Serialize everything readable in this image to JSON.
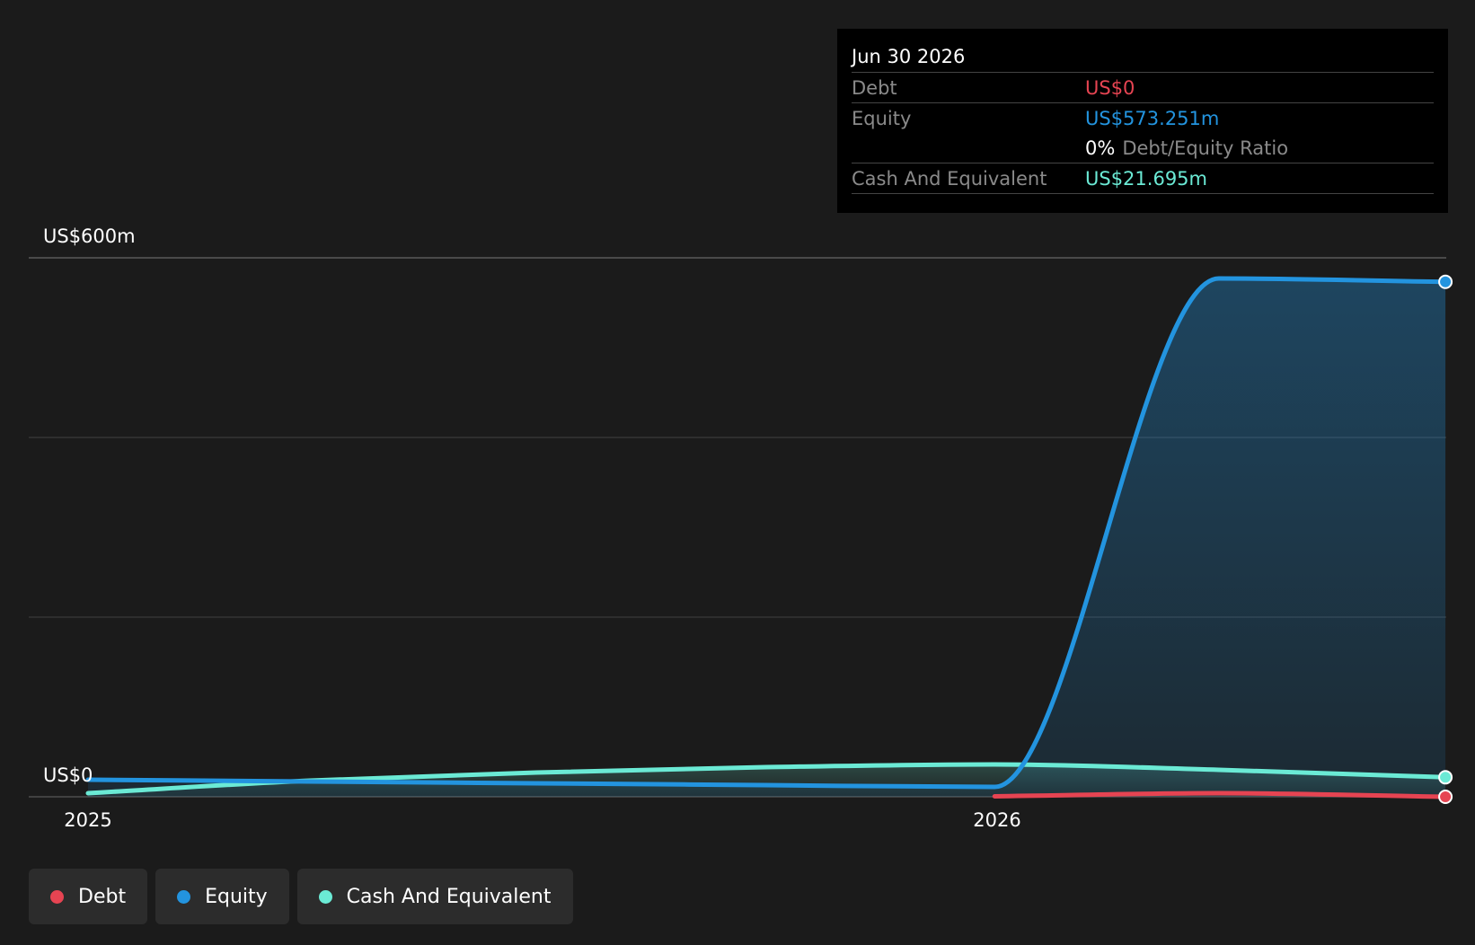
{
  "chart_data": {
    "type": "area",
    "y_tick_labels": [
      "US$600m",
      "US$0"
    ],
    "ylim": [
      0,
      600
    ],
    "x_tick_labels": [
      "2025",
      "2026"
    ],
    "x": [
      "2025-01-01",
      "2025-03-31",
      "2025-06-30",
      "2025-09-30",
      "2025-12-31",
      "2026-03-31",
      "2026-06-30"
    ],
    "series": [
      {
        "name": "Debt",
        "color": "#e64452",
        "values": [
          null,
          null,
          null,
          null,
          0.5,
          4,
          0
        ]
      },
      {
        "name": "Equity",
        "color": "#2394df",
        "values": [
          19,
          17,
          15,
          13,
          11,
          577,
          573.251
        ]
      },
      {
        "name": "Cash And Equivalent",
        "color": "#6bead5",
        "values": [
          4,
          18,
          27,
          33,
          36,
          30,
          21.695
        ]
      }
    ],
    "grid": true,
    "legend": "bottom-left"
  },
  "tooltip": {
    "date": "Jun 30 2026",
    "debt_label": "Debt",
    "debt_value": "US$0",
    "equity_label": "Equity",
    "equity_value": "US$573.251m",
    "ratio_value": "0%",
    "ratio_label": "Debt/Equity Ratio",
    "cash_label": "Cash And Equivalent",
    "cash_value": "US$21.695m"
  },
  "legend": [
    {
      "label": "Debt",
      "color": "#e64452"
    },
    {
      "label": "Equity",
      "color": "#2394df"
    },
    {
      "label": "Cash And Equivalent",
      "color": "#6bead5"
    }
  ]
}
